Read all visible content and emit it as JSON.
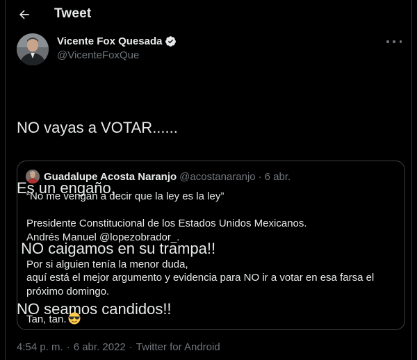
{
  "header": {
    "title": "Tweet"
  },
  "author": {
    "name": "Vicente Fox Quesada",
    "handle": "@VicenteFoxQue",
    "verified_color": "#e7e9ea"
  },
  "tweet": {
    "lines": [
      "NO vayas a VOTAR......",
      "Es un engaño,",
      " NO caigamos en su trampa!!",
      "NO seamos candidos!!"
    ]
  },
  "quote": {
    "name": "Guadalupe Acosta Naranjo",
    "handle": "@acostanaranjo",
    "separator": "·",
    "date": "6 abr.",
    "lines": [
      "“No me vengan a decir que la ley es la ley”",
      "",
      "Presidente Constitucional de los Estados Unidos Mexicanos.",
      "Andrés Manuel @lopezobrador_.",
      "",
      "Por si alguien tenía la menor duda,",
      "aquí está el mejor argumento y evidencia para NO ir a votar en esa farsa el",
      "próximo domingo.",
      "",
      "Tan, tan."
    ],
    "emoji": "smiling-face-with-sunglasses"
  },
  "meta": {
    "time": "4:54 p. m.",
    "date": "6 abr. 2022",
    "source": "Twitter for Android",
    "dot": "·"
  },
  "colors": {
    "background": "#000000",
    "text": "#e7e9ea",
    "secondary": "#71767b",
    "border": "#2f3336"
  }
}
